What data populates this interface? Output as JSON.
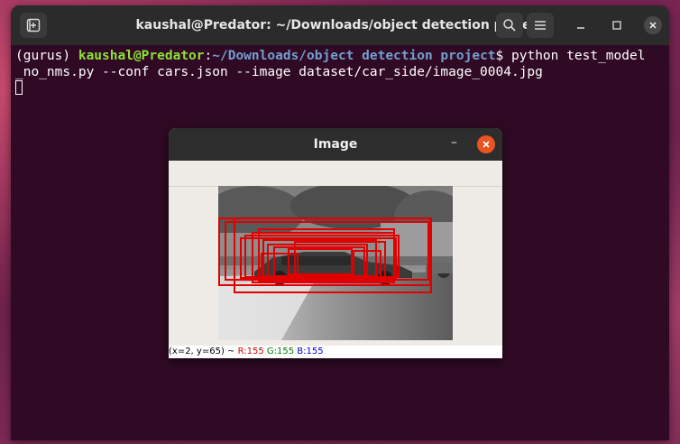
{
  "terminal": {
    "title": "kaushal@Predator: ~/Downloads/object detection project",
    "prompt_env": "(gurus) ",
    "prompt_user": "kaushal@Predator",
    "prompt_sep": ":",
    "prompt_path": "~/Downloads/object detection project",
    "prompt_dollar": "$ ",
    "command_line1": "python test_model",
    "command_line2": "_no_nms.py --conf cars.json --image dataset/car_side/image_0004.jpg"
  },
  "image_window": {
    "title": "Image",
    "status": {
      "coords": "(x=2, y=65) ~ ",
      "r": "R:155",
      "g": "G:155",
      "b": "B:155"
    }
  },
  "colors": {
    "box_color": "#e00000",
    "terminal_bg": "#300a24",
    "close_accent": "#e95420"
  },
  "icons": [
    "new-tab-icon",
    "search-icon",
    "hamburger-menu-icon",
    "minimize-icon",
    "maximize-icon",
    "close-icon"
  ]
}
